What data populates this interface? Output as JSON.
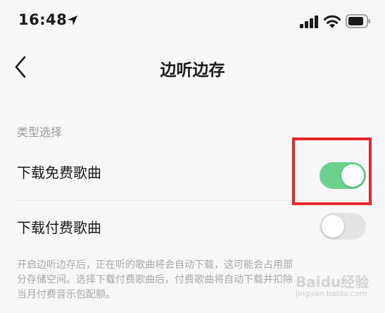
{
  "status_bar": {
    "time": "16:48",
    "icons": [
      "location-arrow-icon",
      "signal-bars-icon",
      "wifi-icon",
      "battery-icon"
    ]
  },
  "nav": {
    "title": "边听边存",
    "back_icon": "chevron-left-icon"
  },
  "section": {
    "header": "类型选择"
  },
  "settings": [
    {
      "label": "下载免费歌曲",
      "enabled": true
    },
    {
      "label": "下载付费歌曲",
      "enabled": false
    }
  ],
  "description": {
    "lines": [
      "开启边听边存后，正在听的歌曲将会自动下载，这可能会占用部",
      "分存储空间。选择下载付费歌曲后，付费歌曲将自动下载并扣除",
      "当月付费音乐包配额。"
    ]
  },
  "colors": {
    "toggle_on": "#6ad28a",
    "toggle_off": "#e4e4e4",
    "highlight": "#e8262c",
    "background": "#f7f7f7"
  },
  "watermark": {
    "text": "Baidu经验",
    "sub": "jingyan.baidu.com"
  }
}
